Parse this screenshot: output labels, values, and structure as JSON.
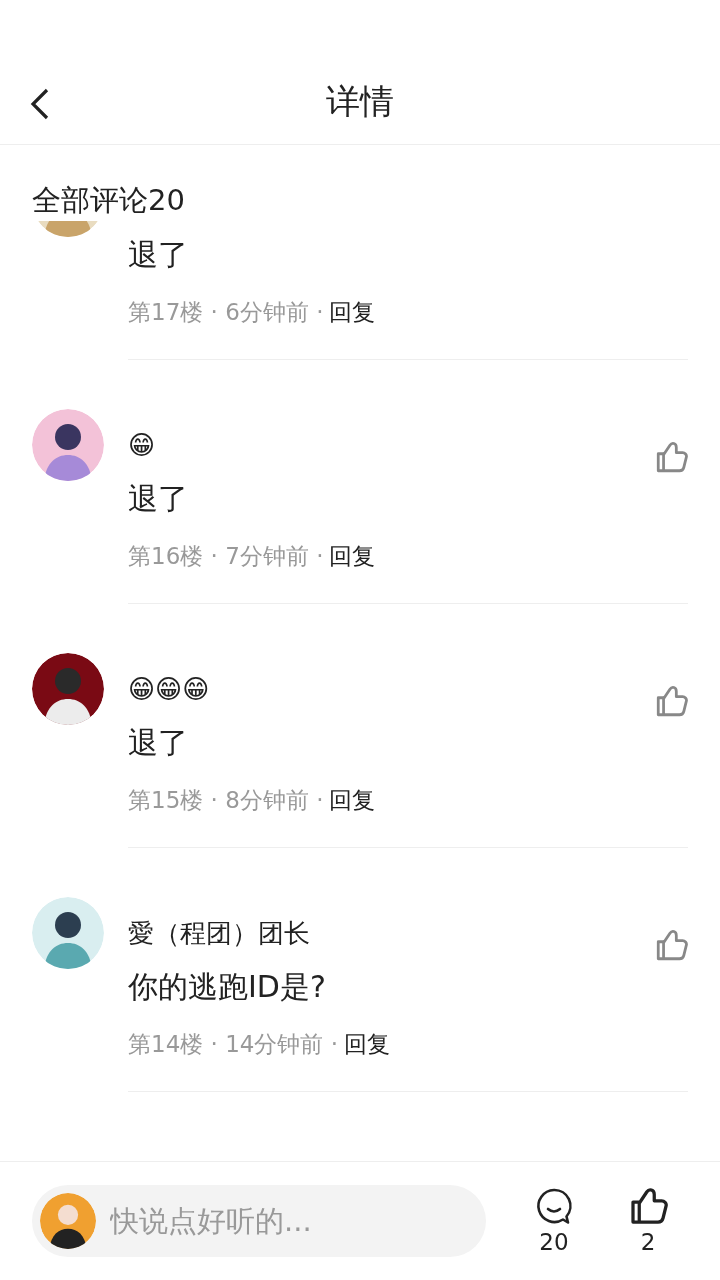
{
  "header": {
    "title": "详情"
  },
  "comment_count_label": "全部评论20",
  "comments": [
    {
      "text": "退了",
      "meta": "第17楼 · 6分钟前 ·",
      "reply": "回复"
    },
    {
      "username": "😁",
      "text": "退了",
      "meta": "第16楼 · 7分钟前 ·",
      "reply": "回复"
    },
    {
      "username": "😁😁😁",
      "text": "退了",
      "meta": "第15楼 · 8分钟前 ·",
      "reply": "回复"
    },
    {
      "username": "愛（程团）团长",
      "text": "你的逃跑ID是?",
      "meta": "第14楼 · 14分钟前 ·",
      "reply": "回复"
    }
  ],
  "composer": {
    "placeholder": "快说点好听的..."
  },
  "actions": [
    {
      "kind": "comment",
      "count": "20"
    },
    {
      "kind": "like",
      "count": "2"
    }
  ]
}
